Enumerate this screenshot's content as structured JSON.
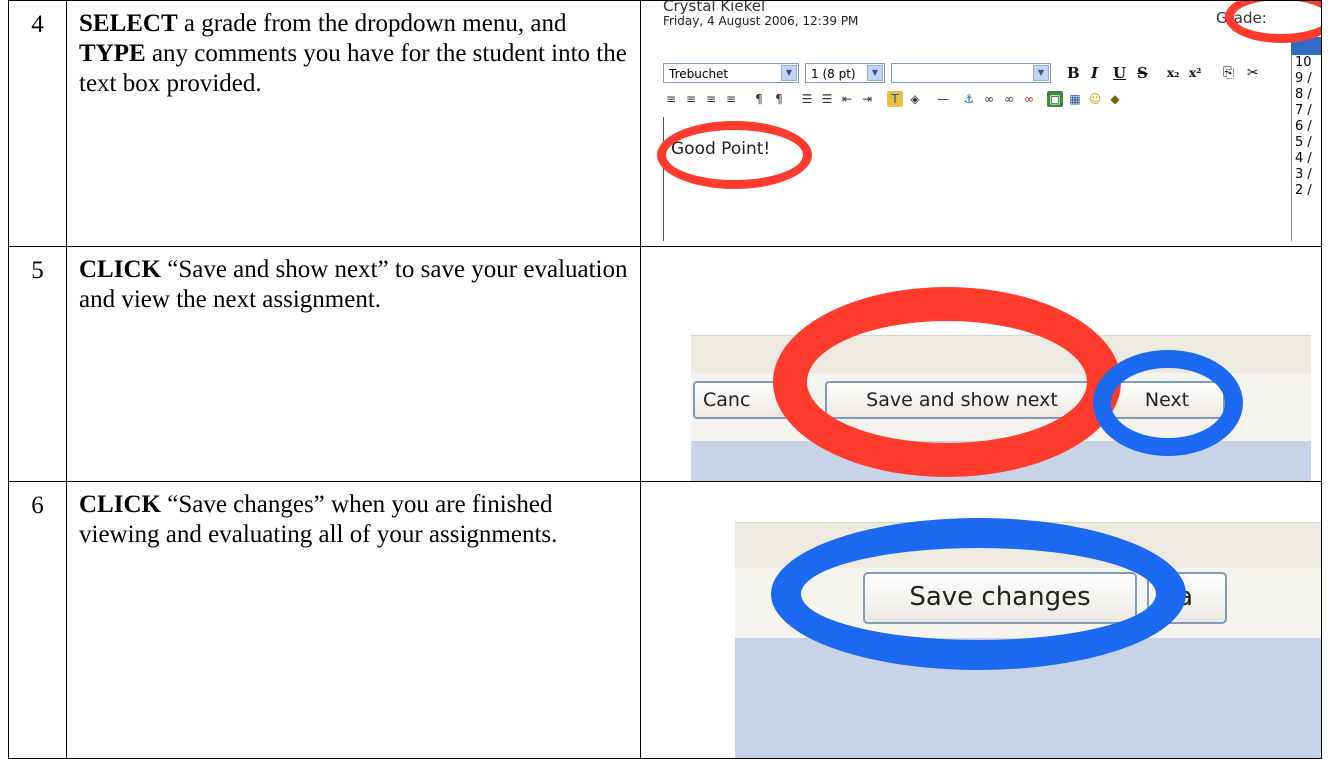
{
  "steps": [
    {
      "number": "4",
      "verb": "SELECT",
      "text_a": " a grade from the dropdown menu, and ",
      "verb2": "TYPE",
      "text_b": " any comments you have for the student into the text box provided."
    },
    {
      "number": "5",
      "verb": "CLICK",
      "text": " “Save and show next” to save your evaluation and view the next assignment."
    },
    {
      "number": "6",
      "verb": "CLICK",
      "text": " “Save changes” when you are finished viewing and evaluating all of your assignments."
    }
  ],
  "editor": {
    "student_name": "Crystal Kiekel",
    "date": "Friday, 4 August 2006, 12:39 PM",
    "grade_label": "Grade:",
    "grade_options": [
      "10",
      "9 /",
      "8 /",
      "7 /",
      "6 /",
      "5 /",
      "4 /",
      "3 /",
      "2 /"
    ],
    "font_value": "Trebuchet",
    "size_value": "1 (8 pt)",
    "comment": "Good Point!"
  },
  "buttons_1": {
    "cancel": "Canc",
    "save_next": "Save and show next",
    "next": "Next"
  },
  "buttons_2": {
    "save_changes": "Save changes",
    "cancel": "Ca"
  },
  "colors": {
    "highlight_red": "#ff3b2e",
    "highlight_blue": "#1b69f0"
  }
}
